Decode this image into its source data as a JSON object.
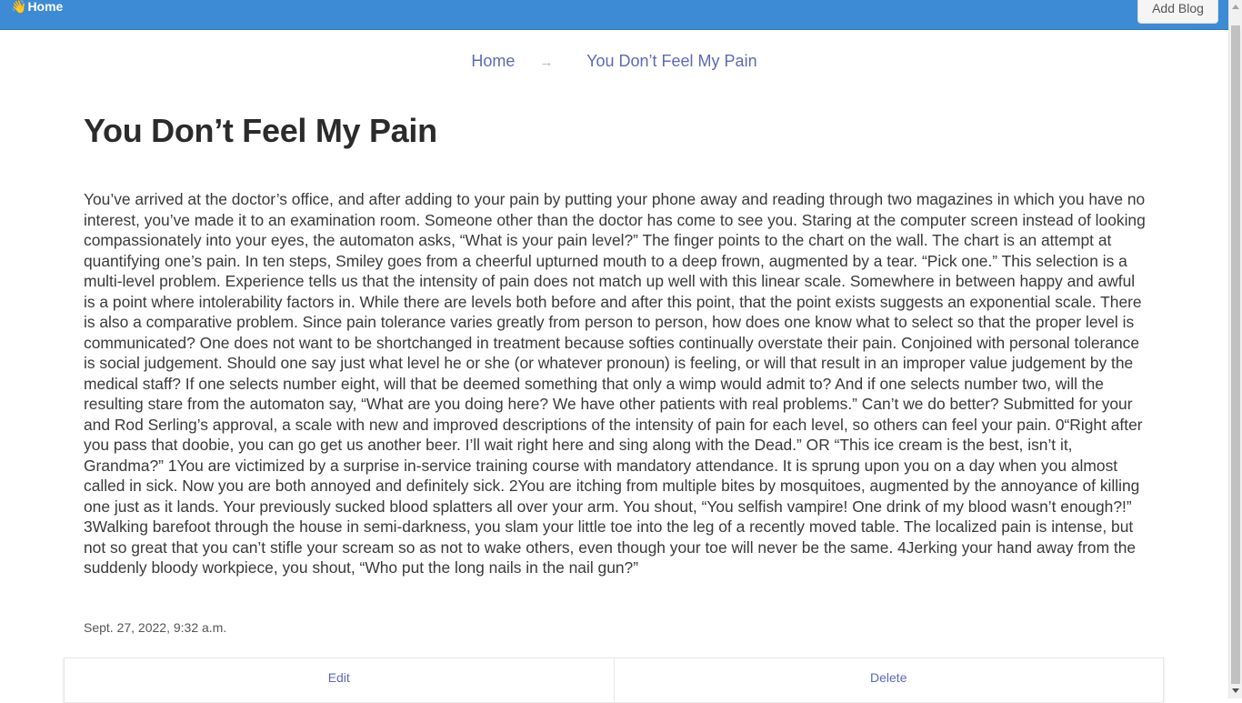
{
  "navbar": {
    "brand_icon": "👋",
    "brand_label": "Home",
    "add_blog_label": "Add Blog",
    "color": "#3d8bd4"
  },
  "breadcrumb": {
    "home_label": "Home",
    "separator": "→",
    "current_label": "You Don’t Feel My Pain"
  },
  "post": {
    "title": "You Don’t Feel My Pain",
    "body": "You’ve arrived at the doctor’s office, and after adding to your pain by putting your phone away and reading through two magazines in which you have no interest, you’ve made it to an examination room. Someone other than the doctor has come to see you. Staring at the computer screen instead of looking compassionately into your eyes, the automaton asks, “What is your pain level?” The finger points to the chart on the wall. The chart is an attempt at quantifying one’s pain. In ten steps, Smiley goes from a cheerful upturned mouth to a deep frown, augmented by a tear. “Pick one.” This selection is a multi-level problem. Experience tells us that the intensity of pain does not match up well with this linear scale. Somewhere in between happy and awful is a point where intolerability factors in. While there are levels both before and after this point, that the point exists suggests an exponential scale. There is also a comparative problem. Since pain tolerance varies greatly from person to person, how does one know what to select so that the proper level is communicated? One does not want to be shortchanged in treatment because softies continually overstate their pain. Conjoined with personal tolerance is social judgement. Should one say just what level he or she (or whatever pronoun) is feeling, or will that result in an improper value judgement by the medical staff? If one selects number eight, will that be deemed something that only a wimp would admit to? And if one selects number two, will the resulting stare from the automaton say, “What are you doing here? We have other patients with real problems.” Can’t we do better? Submitted for your and Rod Serling’s approval, a scale with new and improved descriptions of the intensity of pain for each level, so others can feel your pain. 0“Right after you pass that doobie, you can go get us another beer. I’ll wait right here and sing along with the Dead.” OR “This ice cream is the best, isn’t it, Grandma?” 1You are victimized by a surprise in-service training course with mandatory attendance. It is sprung upon you on a day when you almost called in sick. Now you are both annoyed and definitely sick. 2You are itching from multiple bites by mosquitoes, augmented by the annoyance of killing one just as it lands. Your previously sucked blood splatters all over your arm. You shout, “You selfish vampire! One drink of my blood wasn’t enough?!” 3Walking barefoot through the house in semi-darkness, you slam your little toe into the leg of a recently moved table. The localized pain is intense, but not so great that you can’t stifle your scream so as not to wake others, even though your toe will never be the same. 4Jerking your hand away from the suddenly bloody workpiece, you shout, “Who put the long nails in the nail gun?”",
    "date": "Sept. 27, 2022, 9:32 a.m."
  },
  "actions": {
    "edit_label": "Edit",
    "delete_label": "Delete",
    "link_color": "#5b6ab8"
  }
}
